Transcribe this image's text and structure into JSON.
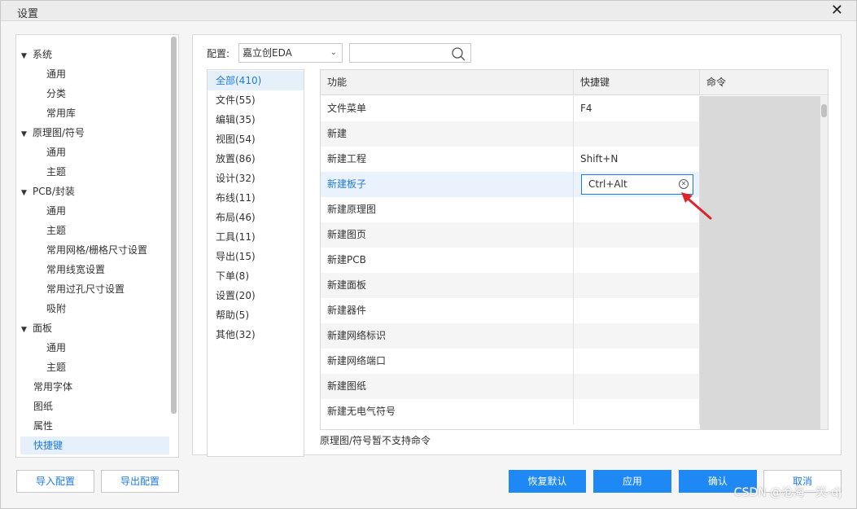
{
  "dialog": {
    "title": "设置",
    "close_icon": "close-icon"
  },
  "tree": [
    {
      "label": "系统",
      "level": 0,
      "expanded": true
    },
    {
      "label": "通用",
      "level": 1
    },
    {
      "label": "分类",
      "level": 1
    },
    {
      "label": "常用库",
      "level": 1
    },
    {
      "label": "原理图/符号",
      "level": 0,
      "expanded": true
    },
    {
      "label": "通用",
      "level": 1
    },
    {
      "label": "主题",
      "level": 1
    },
    {
      "label": "PCB/封装",
      "level": 0,
      "expanded": true
    },
    {
      "label": "通用",
      "level": 1
    },
    {
      "label": "主题",
      "level": 1
    },
    {
      "label": "常用网格/栅格尺寸设置",
      "level": 1
    },
    {
      "label": "常用线宽设置",
      "level": 1
    },
    {
      "label": "常用过孔尺寸设置",
      "level": 1
    },
    {
      "label": "吸附",
      "level": 1
    },
    {
      "label": "面板",
      "level": 0,
      "expanded": true
    },
    {
      "label": "通用",
      "level": 1
    },
    {
      "label": "主题",
      "level": 1
    },
    {
      "label": "常用字体",
      "level": 0
    },
    {
      "label": "图纸",
      "level": 0
    },
    {
      "label": "属性",
      "level": 0
    },
    {
      "label": "快捷键",
      "level": 0,
      "active": true
    }
  ],
  "config": {
    "label": "配置:",
    "selected": "嘉立创EDA",
    "search_placeholder": ""
  },
  "categories": [
    {
      "label": "全部(410)",
      "active": true
    },
    {
      "label": "文件(55)"
    },
    {
      "label": "编辑(35)"
    },
    {
      "label": "视图(54)"
    },
    {
      "label": "放置(86)"
    },
    {
      "label": "设计(32)"
    },
    {
      "label": "布线(11)"
    },
    {
      "label": "布局(46)"
    },
    {
      "label": "工具(11)"
    },
    {
      "label": "导出(15)"
    },
    {
      "label": "下单(8)"
    },
    {
      "label": "设置(20)"
    },
    {
      "label": "帮助(5)"
    },
    {
      "label": "其他(32)"
    }
  ],
  "table": {
    "headers": [
      "功能",
      "快捷键",
      "命令"
    ],
    "rows": [
      {
        "func": "文件菜单",
        "key": "F4"
      },
      {
        "func": "新建",
        "key": ""
      },
      {
        "func": "新建工程",
        "key": "Shift+N"
      },
      {
        "func": "新建板子",
        "key": "",
        "selected": true,
        "editing": "Ctrl+Alt"
      },
      {
        "func": "新建原理图",
        "key": ""
      },
      {
        "func": "新建图页",
        "key": ""
      },
      {
        "func": "新建PCB",
        "key": ""
      },
      {
        "func": "新建面板",
        "key": ""
      },
      {
        "func": "新建器件",
        "key": ""
      },
      {
        "func": "新建网络标识",
        "key": ""
      },
      {
        "func": "新建网络端口",
        "key": ""
      },
      {
        "func": "新建图纸",
        "key": ""
      },
      {
        "func": "新建无电气符号",
        "key": ""
      }
    ]
  },
  "note": "原理图/符号暂不支持命令",
  "buttons": {
    "import": "导入配置",
    "export": "导出配置",
    "restore": "恢复默认",
    "apply": "应用",
    "ok": "确认",
    "cancel": "取消"
  },
  "watermark": "CSDN @沧海一笑-dj",
  "colors": {
    "accent": "#1e7be6",
    "primary_button": "#1e88f5",
    "arrow": "#e0222a"
  }
}
